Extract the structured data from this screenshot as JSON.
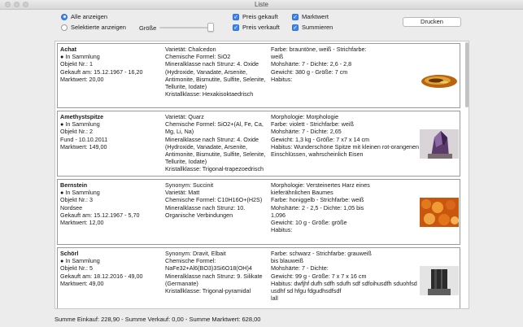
{
  "window": {
    "title": "Liste"
  },
  "toolbar": {
    "radio_all": "Alle anzeigen",
    "radio_selected": "Selektierte anzeigen",
    "size_label": "Größe",
    "chk_purchase_price": "Preis gekauft",
    "chk_sale_price": "Preis verkauft",
    "chk_market_value": "Marktwert",
    "chk_sum": "Summieren",
    "print_button": "Drucken"
  },
  "items": [
    {
      "name": "Achat",
      "status": "In Sammlung",
      "objekt": "Objekt Nr.: 1",
      "source": "Gekauft am: 15.12.1967 - 16,20",
      "market": "Marktwert: 20,00",
      "extra": "",
      "c2": [
        "Varietät: Chalcedon",
        "Chemische Formel: SiO2",
        "Mineralklasse nach Strunz: 4. Oxide",
        "(Hydroxide, Vanadate, Arsenite,",
        "Antimonite, Bismutite, Sulfite, Selenite,",
        "Tellurite, Iodate)",
        "Kristallklasse: Hexakisoktaedrisch"
      ],
      "c3": [
        "Farbe: brauntöne, weiß - Strichfarbe:",
        "weiß",
        "Mohshärte: 7 - Dichte: 2,6 - 2,8",
        "Gewicht: 380 g - Größe: 7 cm",
        "Habitus:"
      ],
      "thumb": "agate-thumbnail"
    },
    {
      "name": "Amethystspitze",
      "status": "In Sammlung",
      "objekt": "Objekt Nr.: 2",
      "source": "Fund - 10.10.2011",
      "market": "Marktwert: 149,00",
      "extra": "",
      "c2": [
        "Varietät: Quarz",
        "Chemische Formel: SiO2+(Al, Fe, Ca,",
        "Mg, Li, Na)",
        "Mineralklasse nach Strunz: 4. Oxide",
        "(Hydroxide, Vanadate, Arsenite,",
        "Antimonite, Bismutite, Sulfite, Selenite,",
        "Tellurite, Iodate)",
        "Kristallklasse: Trigonal-trapezoedrisch"
      ],
      "c3": [
        "Morphologie: Morphologie",
        "Farbe: violett - Strichfarbe: weiß",
        "Mohshärte: 7 - Dichte: 2,65",
        "Gewicht: 1,3 kg - Größe: 7 x7 x 14 cm",
        "Habitus: Wunderschöne Spitze mit kleinen rot-orangenen",
        "Einschlüssen, wahrscheinlich Eisen"
      ],
      "thumb": "amethyst-thumbnail"
    },
    {
      "name": "Bernstein",
      "status": "In Sammlung",
      "objekt": "Objekt Nr.: 3",
      "source": "Nordsee",
      "market": "Gekauft am: 15.12.1967 - 5,70",
      "extra": "Marktwert: 12,00",
      "c2": [
        "Synonym: Succinit",
        "Varietät: Matt",
        "Chemische Formel: C10H16O+(H2S)",
        "Mineralklasse nach Strunz: 10.",
        "Organische Verbindungen"
      ],
      "c3": [
        "Morphologie: Versteinertes Harz eines",
        "kieferähnlichen Baumes",
        "Farbe: honiggelb - Strichfarbe: weiß",
        "Mohshärte: 2 - 2,5 - Dichte: 1,05 bis",
        "1,096",
        "Gewicht: 10 g - Größe: größe",
        "Habitus:"
      ],
      "thumb": "amber-thumbnail"
    },
    {
      "name": "Schörl",
      "status": "In Sammlung",
      "objekt": "Objekt Nr.: 5",
      "source": "Gekauft am: 18.12.2016 - 49,00",
      "market": "Marktwert: 49,00",
      "extra": "",
      "c2": [
        "Synonym: Dravit, Elbait",
        "Chemische Formel:",
        "NaFe32+Al6(BO3)3Si6O18(OH)4",
        "Mineralklasse nach Strunz: 9. Silikate",
        "(Germanate)",
        "Kristallklasse: Trigonal-pyramidal"
      ],
      "c3": [
        "Farbe: schwarz - Strichfarbe: grauweiß",
        "bis blauweiß",
        "Mohshärte: 7 - Dichte:",
        "Gewicht: 99 g - Größe: 7 x 7 x 16 cm",
        "Habitus: dwfjhf dufh sdfh sdufh sdf sdfoihusdfh sduohfsd",
        "usdhf sd hfgu fdgudhsdfsdf",
        "lall"
      ],
      "thumb": "schorl-thumbnail"
    }
  ],
  "footer": {
    "text": "Summe Einkauf: 228,90   -   Summe Verkauf: 0,00   -   Summe Marktwert: 628,00"
  },
  "colors": {
    "accent": "#3b84f3"
  }
}
